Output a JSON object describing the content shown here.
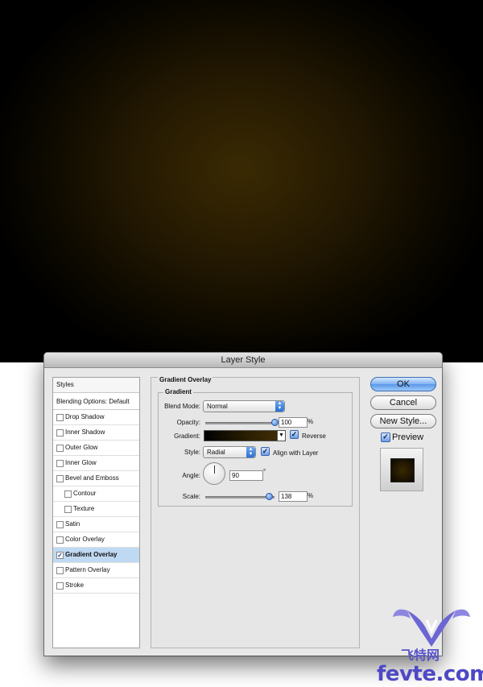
{
  "dialog": {
    "title": "Layer Style"
  },
  "styles_list": {
    "header": "Styles",
    "blending": "Blending Options: Default",
    "items": [
      {
        "label": "Drop Shadow",
        "checked": false,
        "indent": false
      },
      {
        "label": "Inner Shadow",
        "checked": false,
        "indent": false
      },
      {
        "label": "Outer Glow",
        "checked": false,
        "indent": false
      },
      {
        "label": "Inner Glow",
        "checked": false,
        "indent": false
      },
      {
        "label": "Bevel and Emboss",
        "checked": false,
        "indent": false
      },
      {
        "label": "Contour",
        "checked": false,
        "indent": true
      },
      {
        "label": "Texture",
        "checked": false,
        "indent": true
      },
      {
        "label": "Satin",
        "checked": false,
        "indent": false
      },
      {
        "label": "Color Overlay",
        "checked": false,
        "indent": false
      },
      {
        "label": "Gradient Overlay",
        "checked": true,
        "indent": false,
        "selected": true
      },
      {
        "label": "Pattern Overlay",
        "checked": false,
        "indent": false
      },
      {
        "label": "Stroke",
        "checked": false,
        "indent": false
      }
    ]
  },
  "gradient_overlay": {
    "group_title": "Gradient Overlay",
    "sub_title": "Gradient",
    "blend_mode_label": "Blend Mode:",
    "blend_mode_value": "Normal",
    "opacity_label": "Opacity:",
    "opacity_value": "100",
    "opacity_unit": "%",
    "opacity_level": 1.0,
    "gradient_label": "Gradient:",
    "reverse_label": "Reverse",
    "reverse_checked": true,
    "style_label": "Style:",
    "style_value": "Radial",
    "align_label": "Align with Layer",
    "align_checked": true,
    "angle_label": "Angle:",
    "angle_value": "90",
    "angle_unit": "°",
    "scale_label": "Scale:",
    "scale_value": "138",
    "scale_unit": "%",
    "scale_level": 0.92
  },
  "buttons": {
    "ok": "OK",
    "cancel": "Cancel",
    "new_style": "New Style...",
    "preview_label": "Preview",
    "preview_checked": true
  },
  "watermark": {
    "cn": "飞特网",
    "en": "fevte.com"
  },
  "colors": {
    "accent": "#5b98ea",
    "selection": "#c0d9f2",
    "glow": "#3a2a03"
  }
}
